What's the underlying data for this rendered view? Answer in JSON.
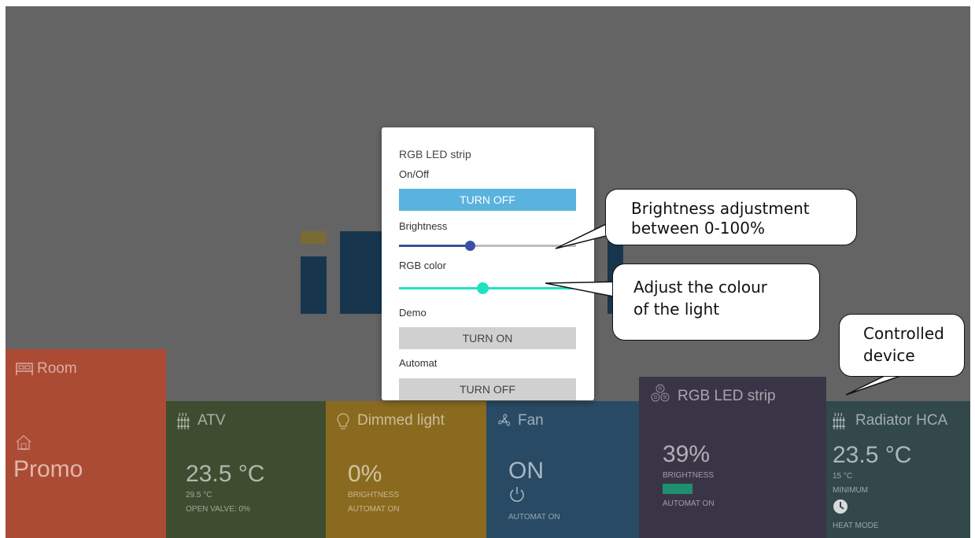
{
  "modal": {
    "title": "RGB LED strip",
    "onoff_label": "On/Off",
    "onoff_button": "TURN OFF",
    "brightness_label": "Brightness",
    "brightness_value": 0.4,
    "rgb_label": "RGB color",
    "rgb_value": 0.47,
    "demo_label": "Demo",
    "demo_button": "TURN ON",
    "automat_label": "Automat",
    "automat_button": "TURN OFF"
  },
  "tiles": {
    "room": {
      "title": "Room",
      "name": "Promo"
    },
    "atv": {
      "title": "ATV",
      "value": "23.5 °C",
      "sub1": "29.5 °C",
      "sub2": "OPEN VALVE: 0%"
    },
    "dimmed": {
      "title": "Dimmed light",
      "value": "0%",
      "sub1": "BRIGHTNESS",
      "sub2": "AUTOMAT ON"
    },
    "fan": {
      "title": "Fan",
      "value": "ON",
      "sub1": "AUTOMAT ON"
    },
    "rgb": {
      "title": "RGB LED strip",
      "value": "39%",
      "sub1": "BRIGHTNESS",
      "sub2": "AUTOMAT ON"
    },
    "radiator": {
      "title": "Radiator HCA",
      "value": "23.5 °C",
      "sub1": "15 °C",
      "sub2": "MINIMUM",
      "sub3": "HEAT MODE"
    }
  },
  "callouts": {
    "brightness_line1": "Brightness adjustment",
    "brightness_line2": "between 0-100%",
    "color_line1": "Adjust the colour",
    "color_line2": "of the light",
    "device_line1": "Controlled",
    "device_line2": "device"
  },
  "colors": {
    "background": "#646464",
    "room": "#ac4b34",
    "atv": "#3e4d30",
    "dimmed": "#8a6a1e",
    "fan": "#284a64",
    "rgb": "#3a3546",
    "radiator": "#32484b",
    "button_primary": "#5ab2df",
    "button_secondary": "#d0d0d0",
    "slider_brightness": "#3d4fa0",
    "slider_rgb": "#22e0c4"
  }
}
